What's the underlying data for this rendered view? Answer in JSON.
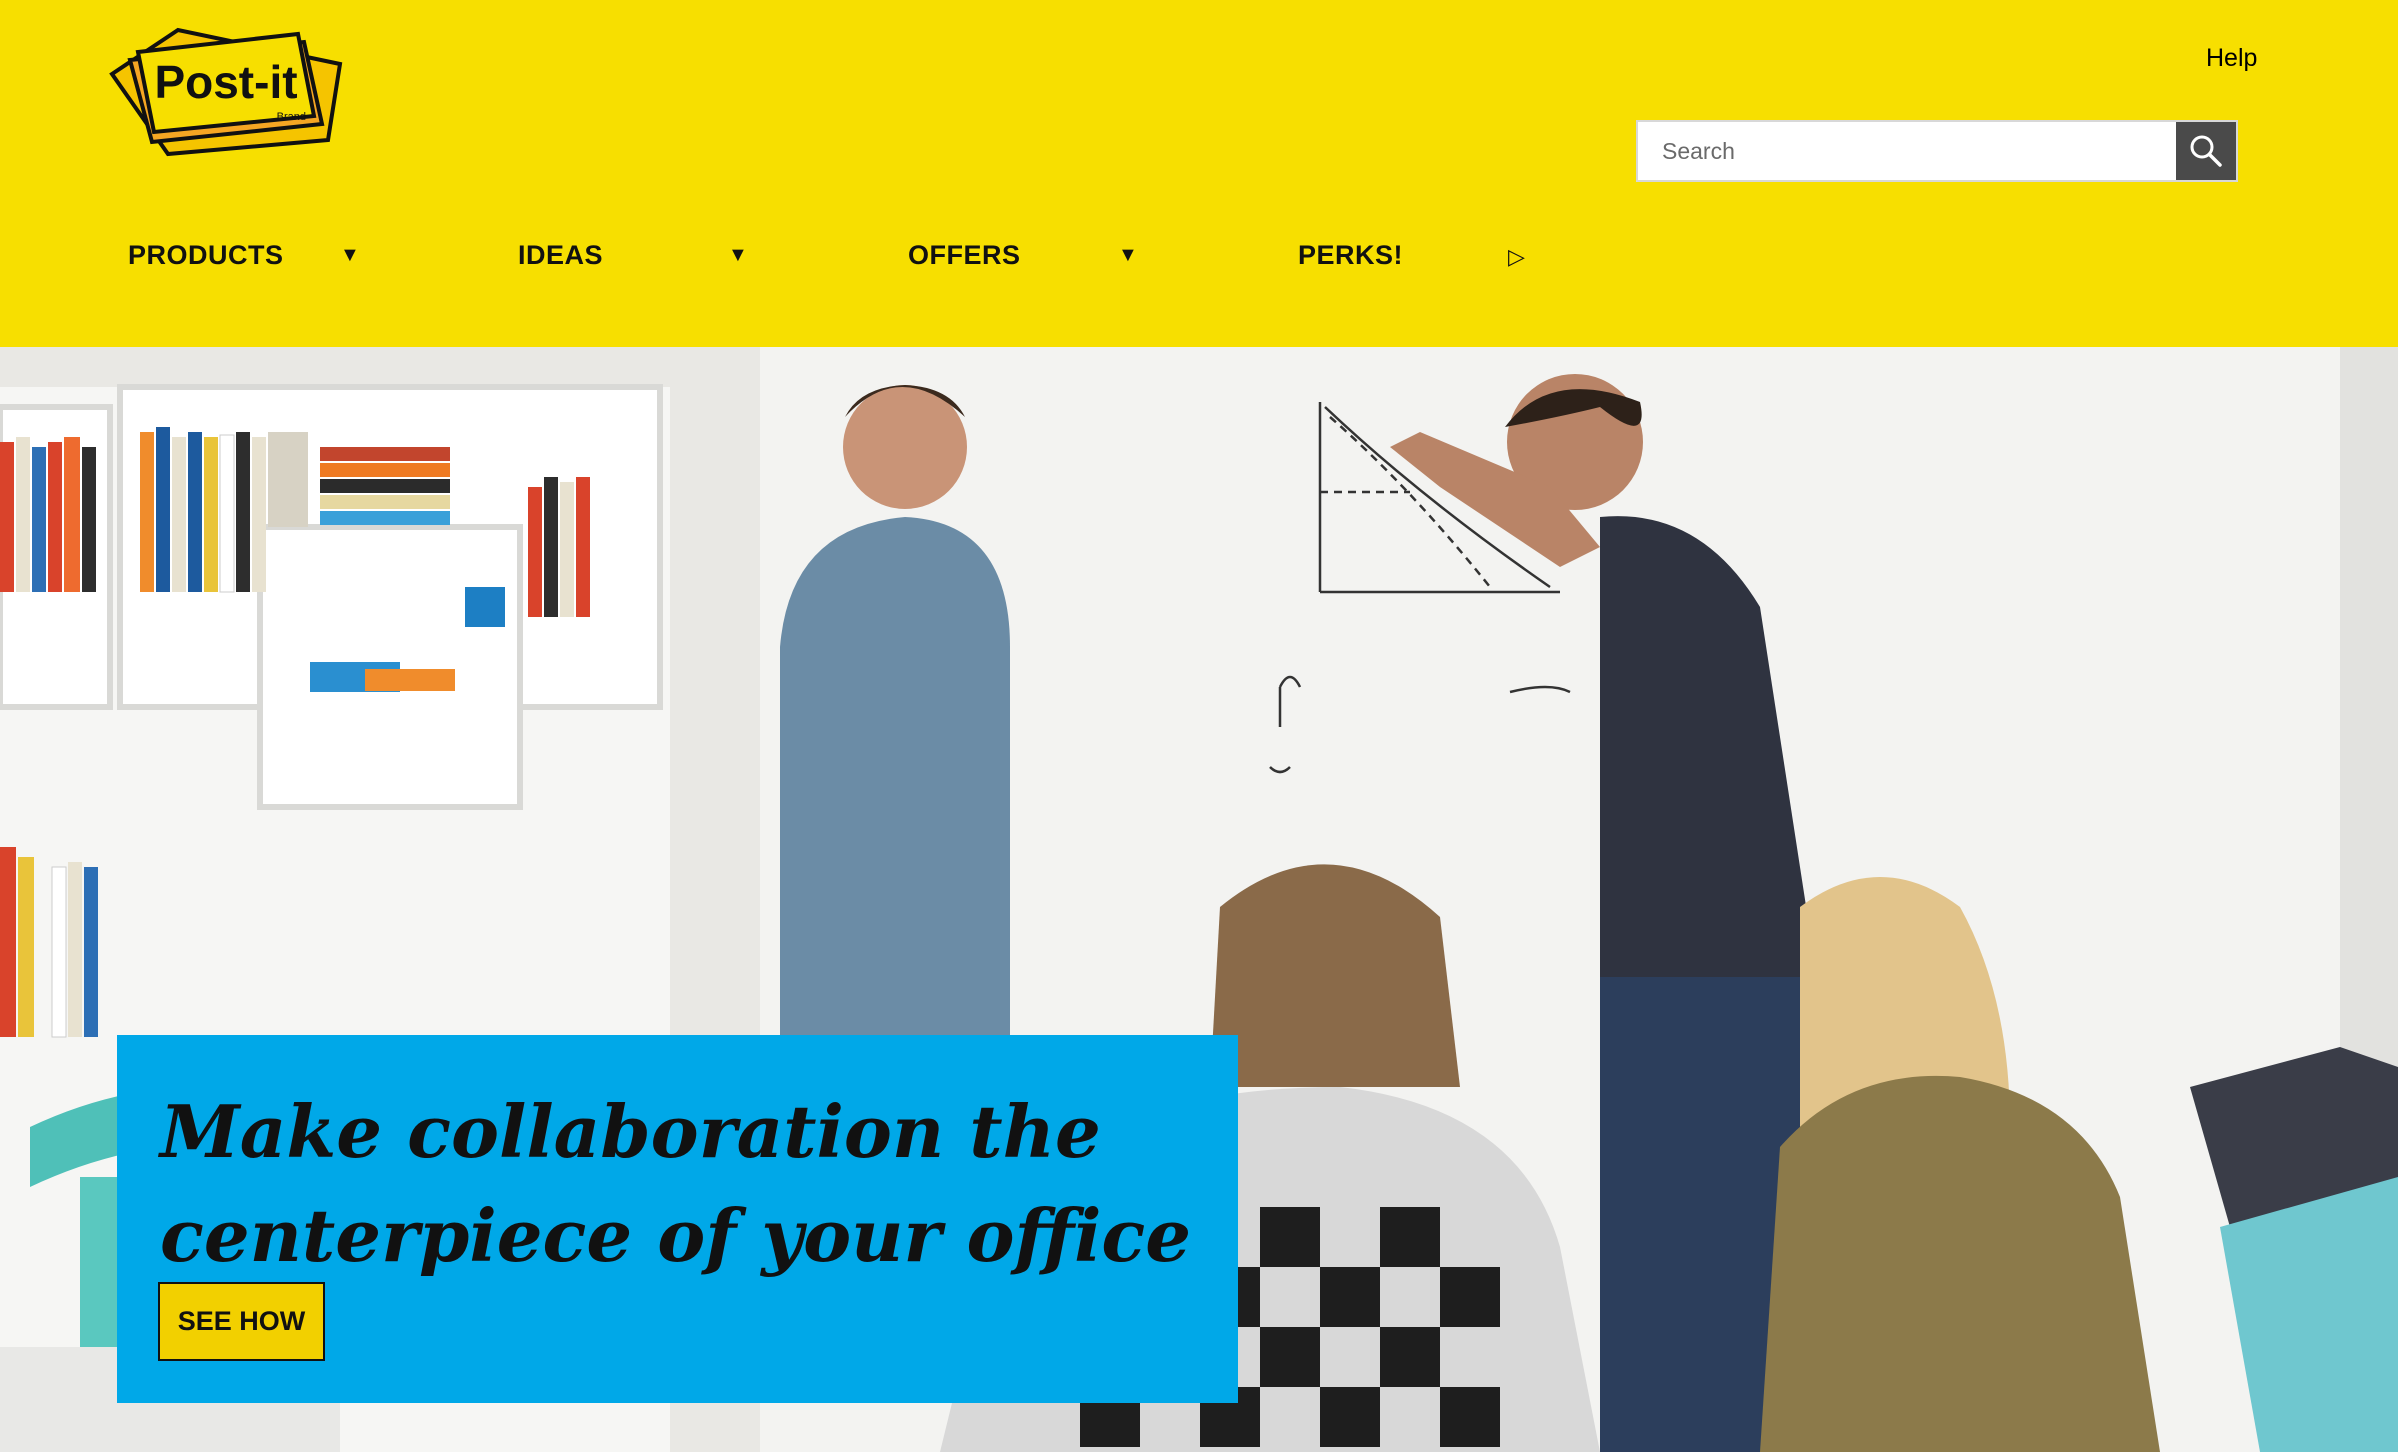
{
  "brand": {
    "logo_text": "Post-it",
    "logo_subtext": "Brand",
    "colors": {
      "header_yellow": "#f7df00",
      "promo_blue": "#00a8e8",
      "button_yellow": "#f2d000",
      "logo_orange": "#f5a623"
    }
  },
  "header": {
    "help_label": "Help",
    "search": {
      "placeholder": "Search",
      "value": "",
      "button_icon": "search-icon"
    }
  },
  "nav": {
    "items": [
      {
        "label": "PRODUCTS",
        "caret": "▼",
        "icon": "caret-down-icon"
      },
      {
        "label": "IDEAS",
        "caret": "▼",
        "icon": "caret-down-icon"
      },
      {
        "label": "OFFERS",
        "caret": "▼",
        "icon": "caret-down-icon"
      },
      {
        "label": "PERKS!",
        "caret": "▷",
        "icon": "caret-right-icon"
      }
    ]
  },
  "hero": {
    "image_alt": "People collaborating at a whiteboard in an office",
    "promo": {
      "title": "Make collaboration the centerpiece of your office",
      "button_label": "SEE HOW"
    }
  }
}
